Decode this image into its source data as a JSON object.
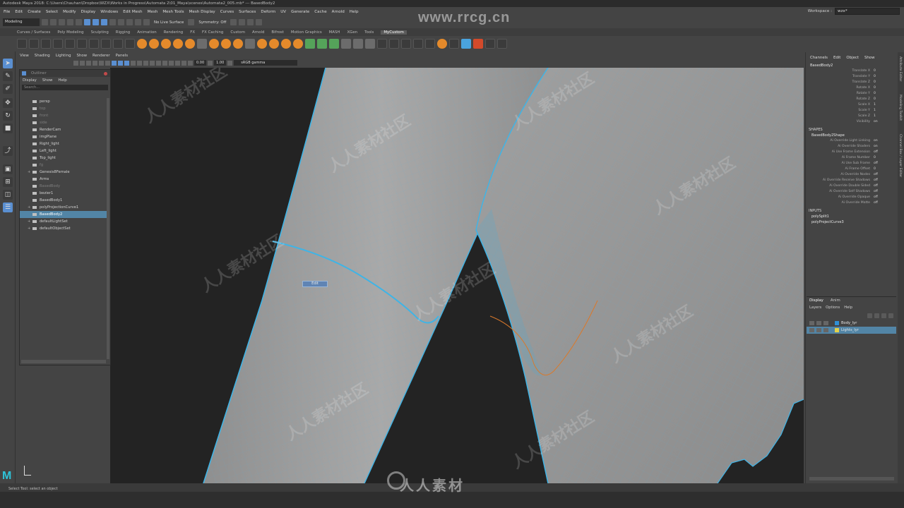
{
  "window": {
    "title": "Autodesk Maya 2018: C:\\Users\\Chauhan\\Dropbox\\WZX\\Works in Progress\\Automata 2\\01_Maya\\scenes\\Automata2_005.mb*   ---   BasedBody2"
  },
  "menubar": {
    "items": [
      "File",
      "Edit",
      "Create",
      "Select",
      "Modify",
      "Display",
      "Windows",
      "Edit Mesh",
      "Mesh",
      "Mesh Tools",
      "Mesh Display",
      "Curves",
      "Surfaces",
      "Deform",
      "UV",
      "Generate",
      "Cache",
      "Arnold",
      "Help"
    ],
    "workspace_label": "Workspace :",
    "workspace_value": "wzx*"
  },
  "statusline": {
    "mode": "Modeling",
    "live_surface": "No Live Surface",
    "symmetry": "Symmetry: Off"
  },
  "shelf": {
    "tabs": [
      "Curves / Surfaces",
      "Poly Modeling",
      "Sculpting",
      "Rigging",
      "Animation",
      "Rendering",
      "FX",
      "FX Caching",
      "Custom",
      "Arnold",
      "Bifrost",
      "Motion Graphics",
      "MASH",
      "XGen",
      "Tools",
      "MyCustom"
    ],
    "active_tab": "MyCustom"
  },
  "panel": {
    "menus": [
      "View",
      "Shading",
      "Lighting",
      "Show",
      "Renderer",
      "Panels"
    ],
    "gamma_value": "0.00",
    "exposure_value": "1.00",
    "color_space": "sRGB gamma"
  },
  "outliner": {
    "title": "Outliner",
    "menus": [
      "Display",
      "Show",
      "Help"
    ],
    "search_placeholder": "Search...",
    "items": [
      {
        "label": "persp",
        "dim": false,
        "selected": false,
        "expand": ""
      },
      {
        "label": "top",
        "dim": true,
        "selected": false,
        "expand": ""
      },
      {
        "label": "front",
        "dim": true,
        "selected": false,
        "expand": ""
      },
      {
        "label": "side",
        "dim": true,
        "selected": false,
        "expand": ""
      },
      {
        "label": "RenderCam",
        "dim": false,
        "selected": false,
        "expand": ""
      },
      {
        "label": "imgPlane",
        "dim": false,
        "selected": false,
        "expand": ""
      },
      {
        "label": "Right_light",
        "dim": false,
        "selected": false,
        "expand": ""
      },
      {
        "label": "Left_light",
        "dim": false,
        "selected": false,
        "expand": ""
      },
      {
        "label": "Top_light",
        "dim": false,
        "selected": false,
        "expand": ""
      },
      {
        "label": "fg",
        "dim": true,
        "selected": false,
        "expand": ""
      },
      {
        "label": "Genesis8Female",
        "dim": false,
        "selected": false,
        "expand": "+"
      },
      {
        "label": "Arms",
        "dim": false,
        "selected": false,
        "expand": ""
      },
      {
        "label": "BasedBody",
        "dim": true,
        "selected": false,
        "expand": ""
      },
      {
        "label": "bezier1",
        "dim": false,
        "selected": false,
        "expand": ""
      },
      {
        "label": "BasedBody1",
        "dim": false,
        "selected": false,
        "expand": ""
      },
      {
        "label": "polyProjectionCurve1",
        "dim": false,
        "selected": false,
        "expand": "+"
      },
      {
        "label": "BasedBody2",
        "dim": false,
        "selected": true,
        "expand": ""
      },
      {
        "label": "defaultLightSet",
        "dim": false,
        "selected": false,
        "expand": "+"
      },
      {
        "label": "defaultObjectSet",
        "dim": false,
        "selected": false,
        "expand": "+"
      }
    ]
  },
  "viewport": {
    "tooltip": "Edit"
  },
  "channelbox": {
    "menus": [
      "Channels",
      "Edit",
      "Object",
      "Show"
    ],
    "node": "BasedBody2",
    "transform_attrs": [
      {
        "name": "Translate X",
        "value": "0"
      },
      {
        "name": "Translate Y",
        "value": "0"
      },
      {
        "name": "Translate Z",
        "value": "0"
      },
      {
        "name": "Rotate X",
        "value": "0"
      },
      {
        "name": "Rotate Y",
        "value": "0"
      },
      {
        "name": "Rotate Z",
        "value": "0"
      },
      {
        "name": "Scale X",
        "value": "1"
      },
      {
        "name": "Scale Y",
        "value": "1"
      },
      {
        "name": "Scale Z",
        "value": "1"
      },
      {
        "name": "Visibility",
        "value": "on"
      }
    ],
    "shapes_label": "SHAPES",
    "shape_node": "BasedBody2Shape",
    "shape_attrs": [
      {
        "name": "Ai Override Light Linking",
        "value": "on"
      },
      {
        "name": "Ai Override Shaders",
        "value": "on"
      },
      {
        "name": "Ai Use Frame Extension",
        "value": "off"
      },
      {
        "name": "Ai Frame Number",
        "value": "0"
      },
      {
        "name": "Ai Use Sub Frame",
        "value": "off"
      },
      {
        "name": "Ai Frame Offset",
        "value": "0"
      },
      {
        "name": "Ai Override Nodes",
        "value": "off"
      },
      {
        "name": "Ai Override Receive Shadows",
        "value": "off"
      },
      {
        "name": "Ai Override Double Sided",
        "value": "off"
      },
      {
        "name": "Ai Override Self Shadows",
        "value": "off"
      },
      {
        "name": "Ai Override Opaque",
        "value": "off"
      },
      {
        "name": "Ai Override Matte",
        "value": "off"
      }
    ],
    "inputs_label": "INPUTS",
    "inputs": [
      "polySplit1",
      "polyProjectCurve3"
    ]
  },
  "layers": {
    "tabs": [
      "Display",
      "Anim"
    ],
    "menus": [
      "Layers",
      "Options",
      "Help"
    ],
    "items": [
      {
        "name": "Body_lyr",
        "color": "#2f8fd6",
        "selected": false
      },
      {
        "name": "Lights_lyr",
        "color": "#e3d24a",
        "selected": true
      }
    ]
  },
  "side_strip": [
    "Attribute Editor",
    "Modeling Toolkit",
    "Channel Box / Layer Editor"
  ],
  "helpline": {
    "text": "Select Tool: select an object"
  },
  "watermarks": {
    "top": "www.rrcg.cn",
    "bottom": "人人素材"
  },
  "logo": {
    "text": "M"
  },
  "colors": {
    "accent": "#5285a6",
    "wire": "#3fb4e6",
    "mesh": "#9a9a9a",
    "curve": "#d9792b"
  }
}
